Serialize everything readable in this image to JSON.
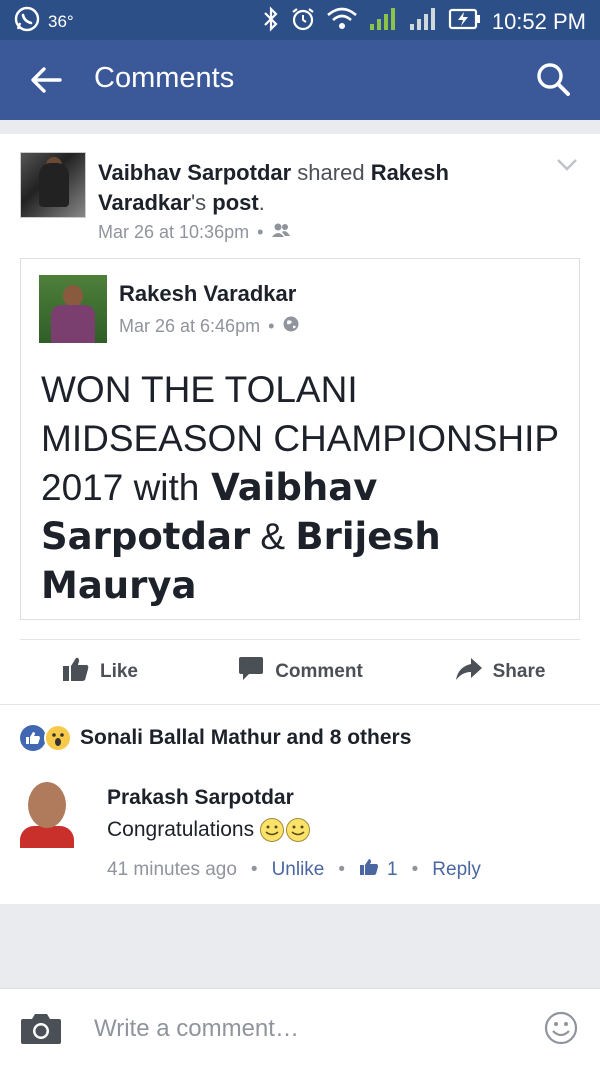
{
  "status_bar": {
    "temperature": "36°",
    "time": "10:52 PM"
  },
  "app_bar": {
    "title": "Comments"
  },
  "post": {
    "sharer_name": "Vaibhav Sarpotdar",
    "shared_word": " shared ",
    "original_author_possessive_name": "Rakesh Varadkar",
    "possessive_suffix": "'s",
    "post_word": " post",
    "period": ".",
    "timestamp": "Mar 26 at 10:36pm",
    "shared_post": {
      "author_name": "Rakesh Varadkar",
      "timestamp": "Mar 26 at 6:46pm",
      "text_line": "WON THE TOLANI MIDSEASON CHAMPIONSHIP 2017 with",
      "mention_1": "Vaibhav Sarpotdar",
      "and_word": " & ",
      "mention_2": "Brijesh Maurya"
    }
  },
  "actions": {
    "like": "Like",
    "comment": "Comment",
    "share": "Share"
  },
  "reactions": {
    "summary": "Sonali Ballal Mathur and 8 others"
  },
  "comment": {
    "author": "Prakash Sarpotdar",
    "text": "Congratulations",
    "time_ago": "41 minutes ago",
    "unlike": "Unlike",
    "like_count": "1",
    "reply": "Reply"
  },
  "composer": {
    "placeholder": "Write a comment…"
  },
  "colors": {
    "status_bar": "#2c4f88",
    "app_bar": "#3b5998",
    "link": "#4b67a1",
    "muted": "#90949c"
  }
}
